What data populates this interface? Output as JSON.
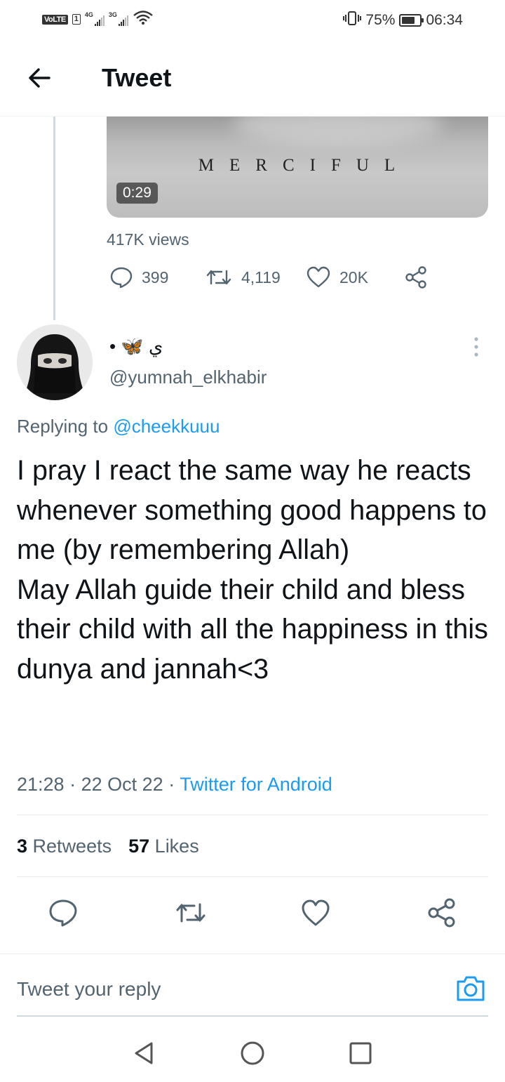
{
  "status_bar": {
    "volte": "VoLTE",
    "sim1": "1",
    "net1": "4G",
    "net2": "3G",
    "battery": "75%",
    "time": "06:34",
    "battery_level": 0.75
  },
  "header": {
    "title": "Tweet"
  },
  "parent_tweet": {
    "video_caption": "MERCIFUL",
    "video_duration": "0:29",
    "views": "417K views",
    "replies": "399",
    "retweets": "4,119",
    "likes": "20K"
  },
  "reply": {
    "display_name": "• 🦋 ي",
    "username": "@yumnah_elkhabir",
    "replying_prefix": "Replying to",
    "replying_handle": "@cheekkuuu",
    "text": "I pray I react the same way he reacts whenever something good happens to me (by remembering Allah)\nMay Allah guide their child and bless their child with all the happiness in this dunya and jannah<3",
    "time": "21:28",
    "date": "22 Oct 22",
    "source": "Twitter for Android",
    "retweets_count": "3",
    "retweets_label": "Retweets",
    "likes_count": "57",
    "likes_label": "Likes"
  },
  "composer": {
    "placeholder": "Tweet your reply"
  },
  "icons": {
    "back": "arrow-left-icon",
    "reply": "speech-bubble-icon",
    "retweet": "retweet-icon",
    "like": "heart-icon",
    "share": "share-icon",
    "camera": "camera-icon",
    "more": "more-vertical-icon"
  },
  "colors": {
    "accent": "#1d9bf0",
    "secondary_text": "#536471",
    "primary_text": "#0f1419"
  }
}
